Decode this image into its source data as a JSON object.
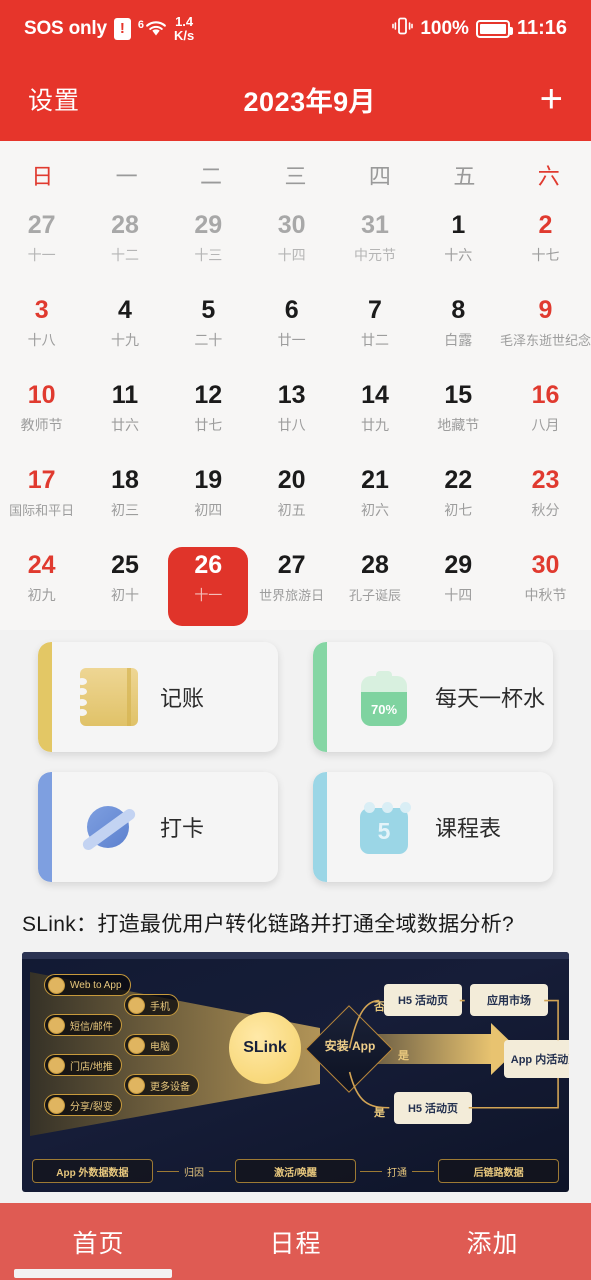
{
  "statusbar": {
    "carrier": "SOS only",
    "sim_badge": "!",
    "wifi_sup": "6",
    "netspeed_value": "1.4",
    "netspeed_unit": "K/s",
    "vibrate_icon": "vibrate-icon",
    "battery_percent": "100%",
    "clock": "11:16"
  },
  "titlebar": {
    "settings_label": "设置",
    "month_title": "2023年9月",
    "add_label": "+"
  },
  "calendar": {
    "weekdays": [
      {
        "label": "日",
        "red": true
      },
      {
        "label": "一",
        "red": false
      },
      {
        "label": "二",
        "red": false
      },
      {
        "label": "三",
        "red": false
      },
      {
        "label": "四",
        "red": false
      },
      {
        "label": "五",
        "red": false
      },
      {
        "label": "六",
        "red": true
      }
    ],
    "days": [
      {
        "n": "27",
        "sub": "十一",
        "out": true,
        "red": false,
        "sel": false
      },
      {
        "n": "28",
        "sub": "十二",
        "out": true,
        "red": false,
        "sel": false
      },
      {
        "n": "29",
        "sub": "十三",
        "out": true,
        "red": false,
        "sel": false
      },
      {
        "n": "30",
        "sub": "十四",
        "out": true,
        "red": false,
        "sel": false
      },
      {
        "n": "31",
        "sub": "中元节",
        "out": true,
        "red": false,
        "sel": false
      },
      {
        "n": "1",
        "sub": "十六",
        "out": false,
        "red": false,
        "sel": false
      },
      {
        "n": "2",
        "sub": "十七",
        "out": false,
        "red": true,
        "sel": false
      },
      {
        "n": "3",
        "sub": "十八",
        "out": false,
        "red": true,
        "sel": false
      },
      {
        "n": "4",
        "sub": "十九",
        "out": false,
        "red": false,
        "sel": false
      },
      {
        "n": "5",
        "sub": "二十",
        "out": false,
        "red": false,
        "sel": false
      },
      {
        "n": "6",
        "sub": "廿一",
        "out": false,
        "red": false,
        "sel": false
      },
      {
        "n": "7",
        "sub": "廿二",
        "out": false,
        "red": false,
        "sel": false
      },
      {
        "n": "8",
        "sub": "白露",
        "out": false,
        "red": false,
        "sel": false
      },
      {
        "n": "9",
        "sub": "毛泽东逝世纪念",
        "out": false,
        "red": true,
        "sel": false
      },
      {
        "n": "10",
        "sub": "教师节",
        "out": false,
        "red": true,
        "sel": false
      },
      {
        "n": "11",
        "sub": "廿六",
        "out": false,
        "red": false,
        "sel": false
      },
      {
        "n": "12",
        "sub": "廿七",
        "out": false,
        "red": false,
        "sel": false
      },
      {
        "n": "13",
        "sub": "廿八",
        "out": false,
        "red": false,
        "sel": false
      },
      {
        "n": "14",
        "sub": "廿九",
        "out": false,
        "red": false,
        "sel": false
      },
      {
        "n": "15",
        "sub": "地藏节",
        "out": false,
        "red": false,
        "sel": false
      },
      {
        "n": "16",
        "sub": "八月",
        "out": false,
        "red": true,
        "sel": false
      },
      {
        "n": "17",
        "sub": "国际和平日",
        "out": false,
        "red": true,
        "sel": false
      },
      {
        "n": "18",
        "sub": "初三",
        "out": false,
        "red": false,
        "sel": false
      },
      {
        "n": "19",
        "sub": "初四",
        "out": false,
        "red": false,
        "sel": false
      },
      {
        "n": "20",
        "sub": "初五",
        "out": false,
        "red": false,
        "sel": false
      },
      {
        "n": "21",
        "sub": "初六",
        "out": false,
        "red": false,
        "sel": false
      },
      {
        "n": "22",
        "sub": "初七",
        "out": false,
        "red": false,
        "sel": false
      },
      {
        "n": "23",
        "sub": "秋分",
        "out": false,
        "red": true,
        "sel": false
      },
      {
        "n": "24",
        "sub": "初九",
        "out": false,
        "red": true,
        "sel": false
      },
      {
        "n": "25",
        "sub": "初十",
        "out": false,
        "red": false,
        "sel": false
      },
      {
        "n": "26",
        "sub": "十一",
        "out": false,
        "red": false,
        "sel": true
      },
      {
        "n": "27",
        "sub": "世界旅游日",
        "out": false,
        "red": false,
        "sel": false
      },
      {
        "n": "28",
        "sub": "孔子诞辰",
        "out": false,
        "red": false,
        "sel": false
      },
      {
        "n": "29",
        "sub": "十四",
        "out": false,
        "red": false,
        "sel": false
      },
      {
        "n": "30",
        "sub": "中秋节",
        "out": false,
        "red": true,
        "sel": false
      }
    ]
  },
  "widgets": [
    {
      "label": "记账",
      "icon": "notebook-icon",
      "accent": "#e3c765"
    },
    {
      "label": "每天一杯水",
      "icon": "water-battery-icon",
      "accent": "#85d6a4",
      "value": "70%"
    },
    {
      "label": "打卡",
      "icon": "planet-icon",
      "accent": "#7e9fe0"
    },
    {
      "label": "课程表",
      "icon": "schedule-calendar-icon",
      "accent": "#9bd6e6",
      "value": "5"
    }
  ],
  "ad": {
    "title": "SLink：打造最优用户转化链路并打通全域数据分析?",
    "diagram": {
      "sources": [
        "Web to App",
        "短信/邮件",
        "门店/地推",
        "分享/裂变"
      ],
      "devices": [
        "手机",
        "电脑",
        "更多设备"
      ],
      "core": "SLink",
      "decision": "安装 App",
      "branch_no": "否",
      "branch_yes_top": "是",
      "branch_yes_bottom": "是",
      "boxes": [
        "H5 活动页",
        "应用市场",
        "App 内活动页",
        "H5 活动页"
      ],
      "footer": [
        "App 外数据数据",
        "归因",
        "激活/唤醒",
        "打通",
        "后链路数据"
      ]
    }
  },
  "bottomnav": {
    "items": [
      {
        "label": "首页"
      },
      {
        "label": "日程"
      },
      {
        "label": "添加"
      }
    ]
  },
  "colors": {
    "header_red": "#e6352b",
    "nav_red": "#df5b53",
    "selected_red": "#e0342a",
    "weekend_red": "#e03a2f"
  }
}
